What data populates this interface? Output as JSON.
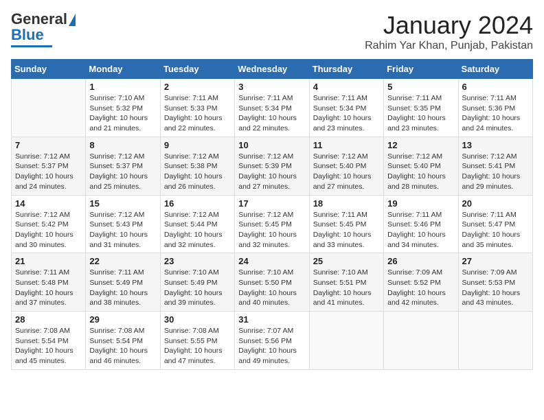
{
  "header": {
    "logo_line1": "General",
    "logo_line2": "Blue",
    "title": "January 2024",
    "subtitle": "Rahim Yar Khan, Punjab, Pakistan"
  },
  "weekdays": [
    "Sunday",
    "Monday",
    "Tuesday",
    "Wednesday",
    "Thursday",
    "Friday",
    "Saturday"
  ],
  "weeks": [
    [
      {
        "day": "",
        "info": ""
      },
      {
        "day": "1",
        "info": "Sunrise: 7:10 AM\nSunset: 5:32 PM\nDaylight: 10 hours\nand 21 minutes."
      },
      {
        "day": "2",
        "info": "Sunrise: 7:11 AM\nSunset: 5:33 PM\nDaylight: 10 hours\nand 22 minutes."
      },
      {
        "day": "3",
        "info": "Sunrise: 7:11 AM\nSunset: 5:34 PM\nDaylight: 10 hours\nand 22 minutes."
      },
      {
        "day": "4",
        "info": "Sunrise: 7:11 AM\nSunset: 5:34 PM\nDaylight: 10 hours\nand 23 minutes."
      },
      {
        "day": "5",
        "info": "Sunrise: 7:11 AM\nSunset: 5:35 PM\nDaylight: 10 hours\nand 23 minutes."
      },
      {
        "day": "6",
        "info": "Sunrise: 7:11 AM\nSunset: 5:36 PM\nDaylight: 10 hours\nand 24 minutes."
      }
    ],
    [
      {
        "day": "7",
        "info": "Sunrise: 7:12 AM\nSunset: 5:37 PM\nDaylight: 10 hours\nand 24 minutes."
      },
      {
        "day": "8",
        "info": "Sunrise: 7:12 AM\nSunset: 5:37 PM\nDaylight: 10 hours\nand 25 minutes."
      },
      {
        "day": "9",
        "info": "Sunrise: 7:12 AM\nSunset: 5:38 PM\nDaylight: 10 hours\nand 26 minutes."
      },
      {
        "day": "10",
        "info": "Sunrise: 7:12 AM\nSunset: 5:39 PM\nDaylight: 10 hours\nand 27 minutes."
      },
      {
        "day": "11",
        "info": "Sunrise: 7:12 AM\nSunset: 5:40 PM\nDaylight: 10 hours\nand 27 minutes."
      },
      {
        "day": "12",
        "info": "Sunrise: 7:12 AM\nSunset: 5:40 PM\nDaylight: 10 hours\nand 28 minutes."
      },
      {
        "day": "13",
        "info": "Sunrise: 7:12 AM\nSunset: 5:41 PM\nDaylight: 10 hours\nand 29 minutes."
      }
    ],
    [
      {
        "day": "14",
        "info": "Sunrise: 7:12 AM\nSunset: 5:42 PM\nDaylight: 10 hours\nand 30 minutes."
      },
      {
        "day": "15",
        "info": "Sunrise: 7:12 AM\nSunset: 5:43 PM\nDaylight: 10 hours\nand 31 minutes."
      },
      {
        "day": "16",
        "info": "Sunrise: 7:12 AM\nSunset: 5:44 PM\nDaylight: 10 hours\nand 32 minutes."
      },
      {
        "day": "17",
        "info": "Sunrise: 7:12 AM\nSunset: 5:45 PM\nDaylight: 10 hours\nand 32 minutes."
      },
      {
        "day": "18",
        "info": "Sunrise: 7:11 AM\nSunset: 5:45 PM\nDaylight: 10 hours\nand 33 minutes."
      },
      {
        "day": "19",
        "info": "Sunrise: 7:11 AM\nSunset: 5:46 PM\nDaylight: 10 hours\nand 34 minutes."
      },
      {
        "day": "20",
        "info": "Sunrise: 7:11 AM\nSunset: 5:47 PM\nDaylight: 10 hours\nand 35 minutes."
      }
    ],
    [
      {
        "day": "21",
        "info": "Sunrise: 7:11 AM\nSunset: 5:48 PM\nDaylight: 10 hours\nand 37 minutes."
      },
      {
        "day": "22",
        "info": "Sunrise: 7:11 AM\nSunset: 5:49 PM\nDaylight: 10 hours\nand 38 minutes."
      },
      {
        "day": "23",
        "info": "Sunrise: 7:10 AM\nSunset: 5:49 PM\nDaylight: 10 hours\nand 39 minutes."
      },
      {
        "day": "24",
        "info": "Sunrise: 7:10 AM\nSunset: 5:50 PM\nDaylight: 10 hours\nand 40 minutes."
      },
      {
        "day": "25",
        "info": "Sunrise: 7:10 AM\nSunset: 5:51 PM\nDaylight: 10 hours\nand 41 minutes."
      },
      {
        "day": "26",
        "info": "Sunrise: 7:09 AM\nSunset: 5:52 PM\nDaylight: 10 hours\nand 42 minutes."
      },
      {
        "day": "27",
        "info": "Sunrise: 7:09 AM\nSunset: 5:53 PM\nDaylight: 10 hours\nand 43 minutes."
      }
    ],
    [
      {
        "day": "28",
        "info": "Sunrise: 7:08 AM\nSunset: 5:54 PM\nDaylight: 10 hours\nand 45 minutes."
      },
      {
        "day": "29",
        "info": "Sunrise: 7:08 AM\nSunset: 5:54 PM\nDaylight: 10 hours\nand 46 minutes."
      },
      {
        "day": "30",
        "info": "Sunrise: 7:08 AM\nSunset: 5:55 PM\nDaylight: 10 hours\nand 47 minutes."
      },
      {
        "day": "31",
        "info": "Sunrise: 7:07 AM\nSunset: 5:56 PM\nDaylight: 10 hours\nand 49 minutes."
      },
      {
        "day": "",
        "info": ""
      },
      {
        "day": "",
        "info": ""
      },
      {
        "day": "",
        "info": ""
      }
    ]
  ]
}
